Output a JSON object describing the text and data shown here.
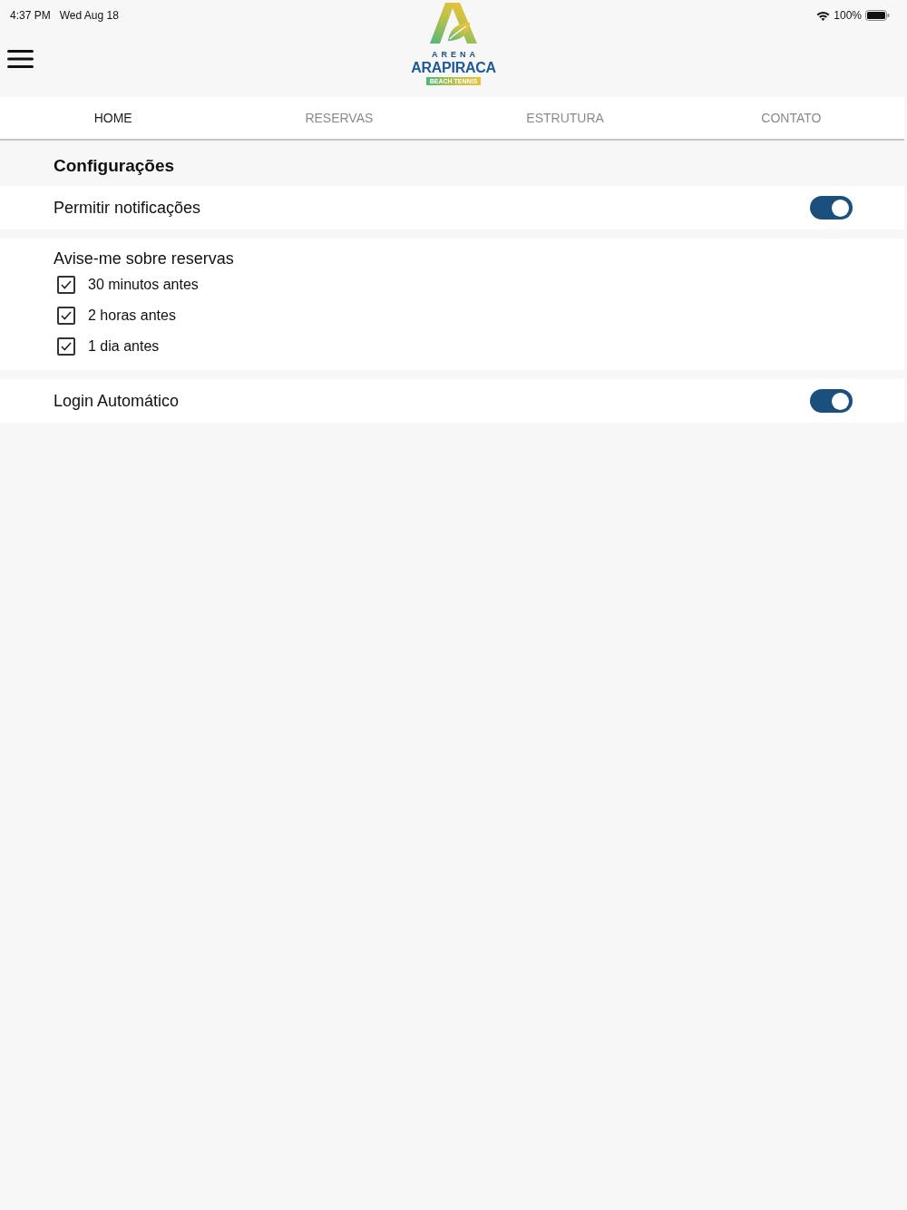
{
  "status_bar": {
    "time": "4:37 PM",
    "date": "Wed Aug 18",
    "battery": "100%"
  },
  "header": {
    "logo": {
      "top": "ARENA",
      "name": "ARAPIRACA",
      "tagline": "BEACH TENNIS"
    }
  },
  "tabs": [
    {
      "label": "HOME",
      "selected": true
    },
    {
      "label": "RESERVAS",
      "selected": false
    },
    {
      "label": "ESTRUTURA",
      "selected": false
    },
    {
      "label": "CONTATO",
      "selected": false
    }
  ],
  "settings": {
    "title": "Configurações",
    "sections": [
      {
        "kind": "toggle",
        "label": "Permitir notificações",
        "on": true
      },
      {
        "kind": "checklist",
        "label": "Avise-me sobre reservas",
        "options": [
          {
            "label": "30 minutos antes",
            "checked": true
          },
          {
            "label": "2 horas antes",
            "checked": true
          },
          {
            "label": "1 dia antes",
            "checked": true
          }
        ]
      },
      {
        "kind": "toggle",
        "label": "Login Automático",
        "on": true
      }
    ]
  }
}
